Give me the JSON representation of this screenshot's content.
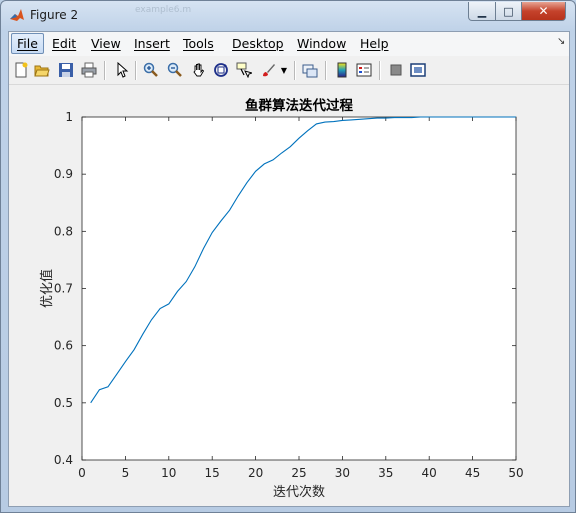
{
  "window": {
    "title": "Figure 2",
    "background_hint": "example6.m",
    "minimize_glyph": "▁",
    "maximize_glyph": "□",
    "close_glyph": "✕"
  },
  "menu": [
    "File",
    "Edit",
    "View",
    "Insert",
    "Tools",
    "Desktop",
    "Window",
    "Help"
  ],
  "menu_dock_glyph": "↘",
  "toolbar": [
    "new-figure-icon",
    "open-icon",
    "save-icon",
    "print-icon",
    "select-arrow-icon",
    "zoom-in-icon",
    "zoom-out-icon",
    "pan-hand-icon",
    "rotate-3d-icon",
    "data-cursor-icon",
    "brush-icon",
    "brush-dropdown-icon",
    "link-plot-icon",
    "colorbar-icon",
    "legend-icon",
    "hide-plot-tools-icon",
    "show-plot-tools-icon"
  ],
  "chart_data": {
    "type": "line",
    "title": "鱼群算法迭代过程",
    "xlabel": "迭代次数",
    "ylabel": "优化值",
    "xlim": [
      0,
      50
    ],
    "ylim": [
      0.4,
      1
    ],
    "xticks": [
      0,
      5,
      10,
      15,
      20,
      25,
      30,
      35,
      40,
      45,
      50
    ],
    "yticks": [
      0.4,
      0.5,
      0.6,
      0.7,
      0.8,
      0.9,
      1
    ],
    "grid": false,
    "line_color": "#0072bd",
    "series": [
      {
        "x": [
          1,
          2,
          3,
          4,
          5,
          6,
          7,
          8,
          9,
          10,
          11,
          12,
          13,
          14,
          15,
          16,
          17,
          18,
          19,
          20,
          21,
          22,
          23,
          24,
          25,
          26,
          27,
          28,
          29,
          30,
          31,
          32,
          33,
          34,
          35,
          36,
          37,
          38,
          39,
          40,
          41,
          42,
          43,
          44,
          45,
          46,
          47,
          48,
          49,
          50
        ],
        "values": [
          0.5,
          0.523,
          0.528,
          0.55,
          0.572,
          0.593,
          0.62,
          0.645,
          0.665,
          0.673,
          0.695,
          0.712,
          0.738,
          0.77,
          0.798,
          0.818,
          0.837,
          0.862,
          0.885,
          0.905,
          0.918,
          0.925,
          0.937,
          0.948,
          0.963,
          0.976,
          0.988,
          0.991,
          0.992,
          0.994,
          0.995,
          0.996,
          0.997,
          0.998,
          0.998,
          0.999,
          0.999,
          0.999,
          1.0,
          1.0,
          1.0,
          1.0,
          1.0,
          1.0,
          1.0,
          1.0,
          1.0,
          1.0,
          1.0,
          1.0
        ]
      }
    ]
  }
}
